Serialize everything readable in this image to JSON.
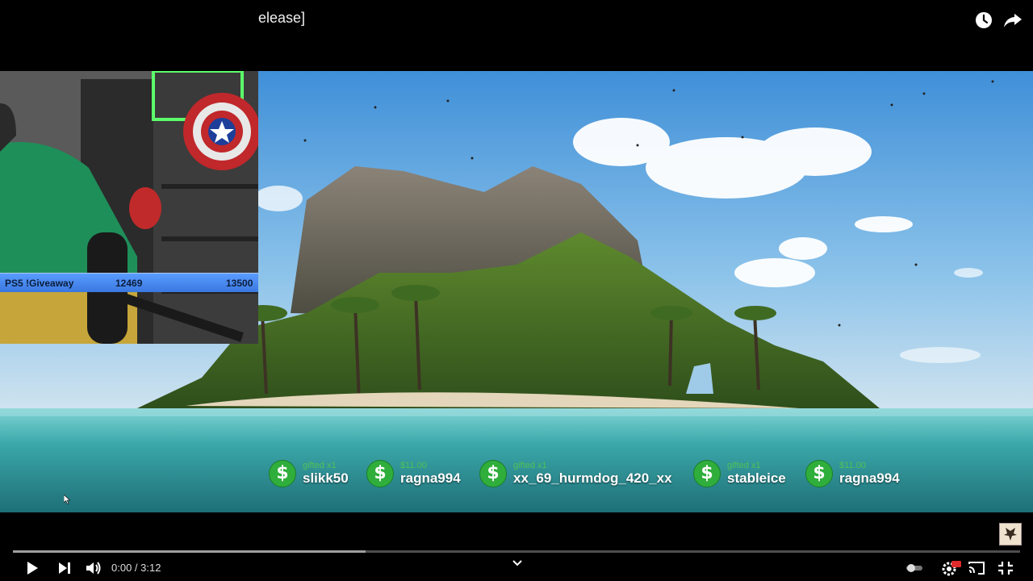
{
  "video": {
    "title": "elease]",
    "time_display": "0:00 / 3:12",
    "progress_buffered": 0.35
  },
  "overlay": {
    "stream_bar": {
      "label": "PS5 !Giveaway",
      "current": "12469",
      "goal": "13500"
    }
  },
  "alerts": [
    {
      "sub": "gifted x1",
      "name": "slikk50"
    },
    {
      "sub": "$11.00",
      "name": "ragna994"
    },
    {
      "sub": "gifted x1",
      "name": "xx_69_hurmdog_420_xx"
    },
    {
      "sub": "gifted x1",
      "name": "stableice"
    },
    {
      "sub": "$11.00",
      "name": "ragna994"
    }
  ],
  "alert_coin_symbol": "$",
  "icons": {
    "top": [
      "clock-icon",
      "share-icon"
    ],
    "controls": [
      "play-icon",
      "next-icon",
      "volume-icon",
      "chevron-up-icon",
      "autoplay-toggle-icon",
      "settings-icon",
      "cast-icon",
      "exit-fullscreen-icon"
    ]
  },
  "colors": {
    "sky": "#5aa6e6",
    "sea": "#3aa7a8",
    "alert_green": "#2fae3c",
    "stream_bar_blue": "#4a8cf0"
  }
}
